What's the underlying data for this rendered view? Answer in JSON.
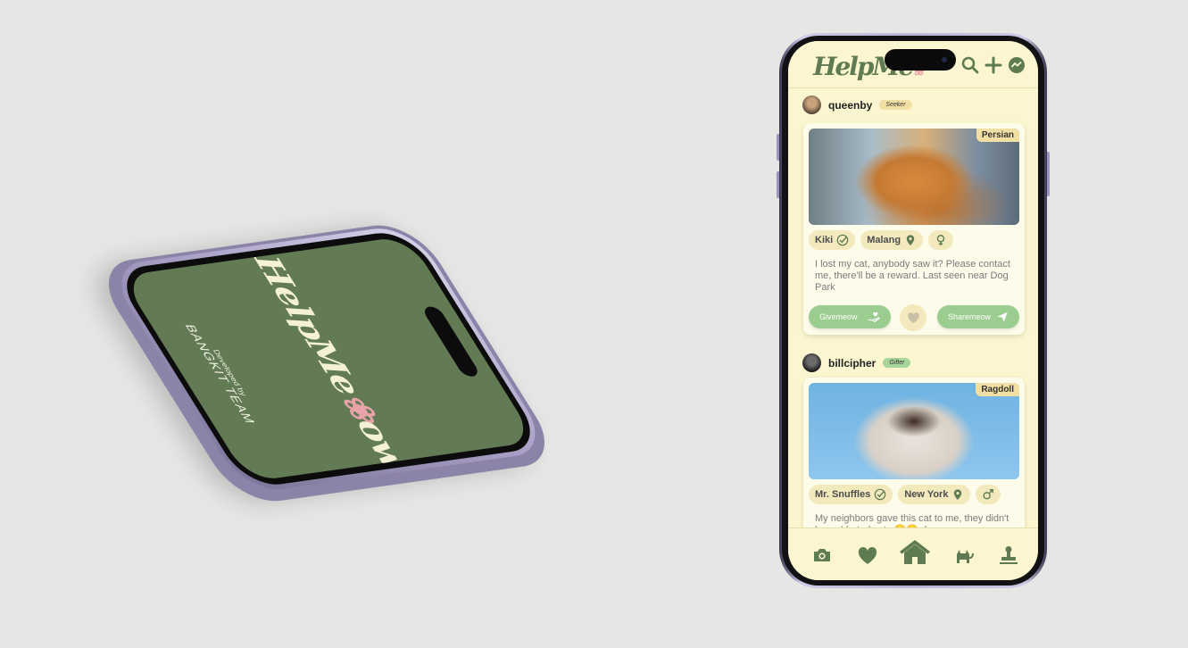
{
  "splash": {
    "logo_main": "HelpMe",
    "logo_tail": "ow",
    "developed_by": "Developed by",
    "team": "BANGKIT TEAM"
  },
  "app": {
    "logo_main": "HelpMe",
    "logo_tail": "ow",
    "top_icons": [
      "search-icon",
      "add-icon",
      "messenger-icon"
    ],
    "colors": {
      "background": "#fbf6cf",
      "primary_green": "#5f7b52",
      "button_green": "#9ccd90",
      "chip": "#f2e9bd",
      "accent_pink": "#e8a3a9",
      "splash_green": "#627b55"
    }
  },
  "posts": [
    {
      "username": "queenby",
      "role": "Seeker",
      "breed": "Persian",
      "cat_name": "Kiki",
      "location": "Malang",
      "gender_icon": "female-icon",
      "description": "I lost my cat, anybody saw it? Please contact me, there'll be a reward. Last seen near Dog Park",
      "give_label": "Givemeow",
      "share_label": "Sharemeow"
    },
    {
      "username": "billcipher",
      "role": "Gifter",
      "breed": "Ragdoll",
      "cat_name": "Mr. Snuffles",
      "location": "New York",
      "gender_icon": "male-icon",
      "description": "My neighbors gave this cat to me, they didn't know I hated cats 😒😒 does"
    }
  ],
  "bottom_nav": [
    "camera-icon",
    "heart-icon",
    "home-icon",
    "cat-icon",
    "stamp-icon"
  ]
}
